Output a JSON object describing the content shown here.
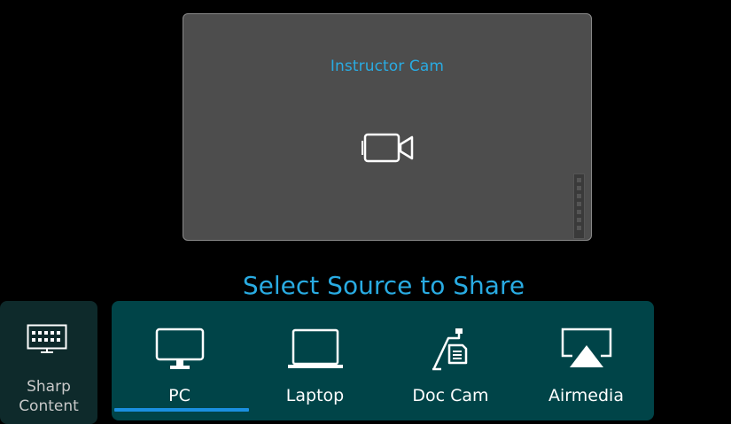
{
  "preview": {
    "title": "Instructor Cam",
    "icon": "video-camera-icon"
  },
  "heading": "Select Source to Share",
  "sharp_content": {
    "label_line1": "Sharp",
    "label_line2": "Content",
    "icon": "keyboard-display-icon"
  },
  "sources": [
    {
      "label": "PC",
      "icon": "monitor-icon",
      "selected": true
    },
    {
      "label": "Laptop",
      "icon": "laptop-icon",
      "selected": false
    },
    {
      "label": "Doc Cam",
      "icon": "document-camera-icon",
      "selected": false
    },
    {
      "label": "Airmedia",
      "icon": "airplay-icon",
      "selected": false
    }
  ],
  "colors": {
    "accent": "#29abe2",
    "selected_underline": "#1a8fe0",
    "sources_bg": "#004448",
    "preview_bg": "#4d4d4d"
  }
}
